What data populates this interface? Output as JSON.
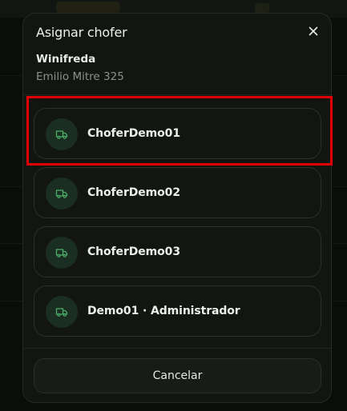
{
  "modal": {
    "title": "Asignar chofer",
    "client_name": "Winifreda",
    "client_address": "Emilio Mitre 325",
    "drivers": [
      {
        "label": "ChoferDemo01"
      },
      {
        "label": "ChoferDemo02"
      },
      {
        "label": "ChoferDemo03"
      },
      {
        "label": "Demo01 · Administrador"
      }
    ],
    "cancel_label": "Cancelar"
  },
  "colors": {
    "accent_green": "#4caf6a",
    "highlight_red": "#e00000"
  },
  "icons": {
    "close": "close-icon",
    "driver": "truck-icon"
  }
}
